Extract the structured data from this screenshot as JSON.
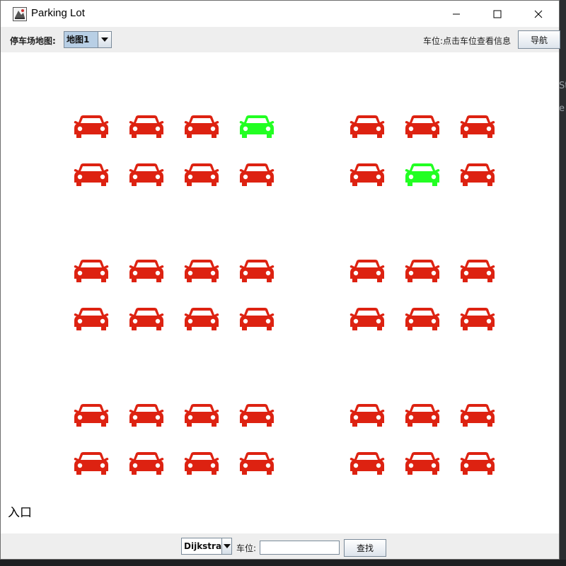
{
  "window": {
    "title": "Parking Lot"
  },
  "toolbar": {
    "map_label": "停车场地图:",
    "map_selected": "地图1",
    "info_text": "车位:点击车位查看信息",
    "nav_button": "导航"
  },
  "canvas": {
    "entrance_label": "入口",
    "colors": {
      "occupied": "#dd2211",
      "free": "#22ff22"
    },
    "blocks": [
      {
        "name": "block-top-left",
        "rows": [
          [
            "occupied",
            "occupied",
            "occupied",
            "free"
          ],
          [
            "occupied",
            "occupied",
            "occupied",
            "occupied"
          ]
        ]
      },
      {
        "name": "block-top-right",
        "rows": [
          [
            "occupied",
            "occupied",
            "occupied"
          ],
          [
            "occupied",
            "free",
            "occupied"
          ]
        ]
      },
      {
        "name": "block-middle-left",
        "rows": [
          [
            "occupied",
            "occupied",
            "occupied",
            "occupied"
          ],
          [
            "occupied",
            "occupied",
            "occupied",
            "occupied"
          ]
        ]
      },
      {
        "name": "block-middle-right",
        "rows": [
          [
            "occupied",
            "occupied",
            "occupied"
          ],
          [
            "occupied",
            "occupied",
            "occupied"
          ]
        ]
      },
      {
        "name": "block-bottom-left",
        "rows": [
          [
            "occupied",
            "occupied",
            "occupied",
            "occupied"
          ],
          [
            "occupied",
            "occupied",
            "occupied",
            "occupied"
          ]
        ]
      },
      {
        "name": "block-bottom-right",
        "rows": [
          [
            "occupied",
            "occupied",
            "occupied"
          ],
          [
            "occupied",
            "occupied",
            "occupied"
          ]
        ]
      }
    ]
  },
  "bottombar": {
    "algorithm_selected": "Dijkstra",
    "spot_label": "车位:",
    "spot_value": "",
    "search_button": "查找"
  }
}
